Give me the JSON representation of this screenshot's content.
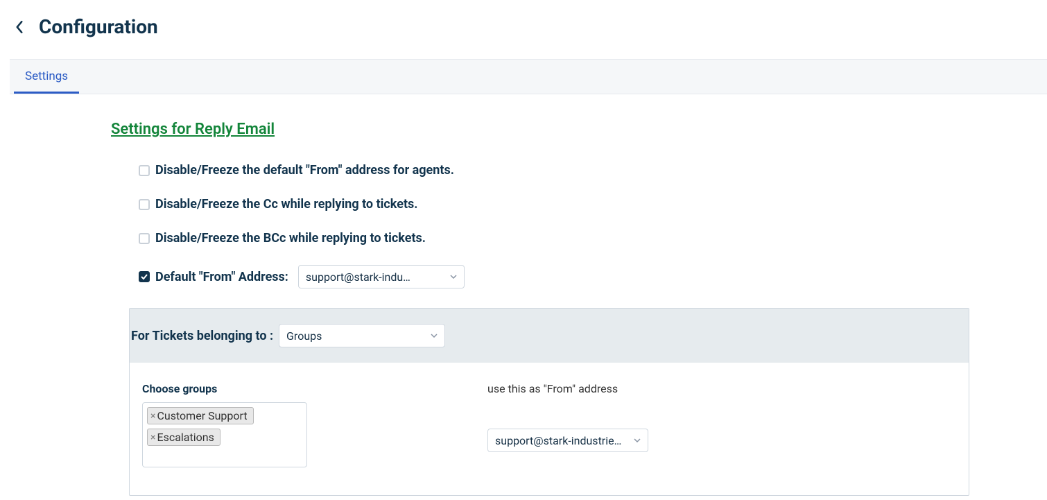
{
  "header": {
    "title": "Configuration"
  },
  "tabs": {
    "settings": "Settings"
  },
  "section": {
    "title": "Settings for Reply Email"
  },
  "options": {
    "disable_from": {
      "label": "Disable/Freeze the default \"From\" address for agents.",
      "checked": false
    },
    "disable_cc": {
      "label": "Disable/Freeze the Cc while replying to tickets.",
      "checked": false
    },
    "disable_bcc": {
      "label": "Disable/Freeze the BCc while replying to tickets.",
      "checked": false
    },
    "default_from": {
      "label": "Default \"From\" Address:",
      "checked": true,
      "value": "support@stark-indu…"
    }
  },
  "rules": {
    "belonging_label": "For Tickets belonging to :",
    "belonging_value": "Groups",
    "choose_groups_label": "Choose groups",
    "groups": [
      "Customer Support",
      "Escalations"
    ],
    "use_from_label": "use this as \"From\" address",
    "use_from_value": "support@stark-industries…"
  }
}
